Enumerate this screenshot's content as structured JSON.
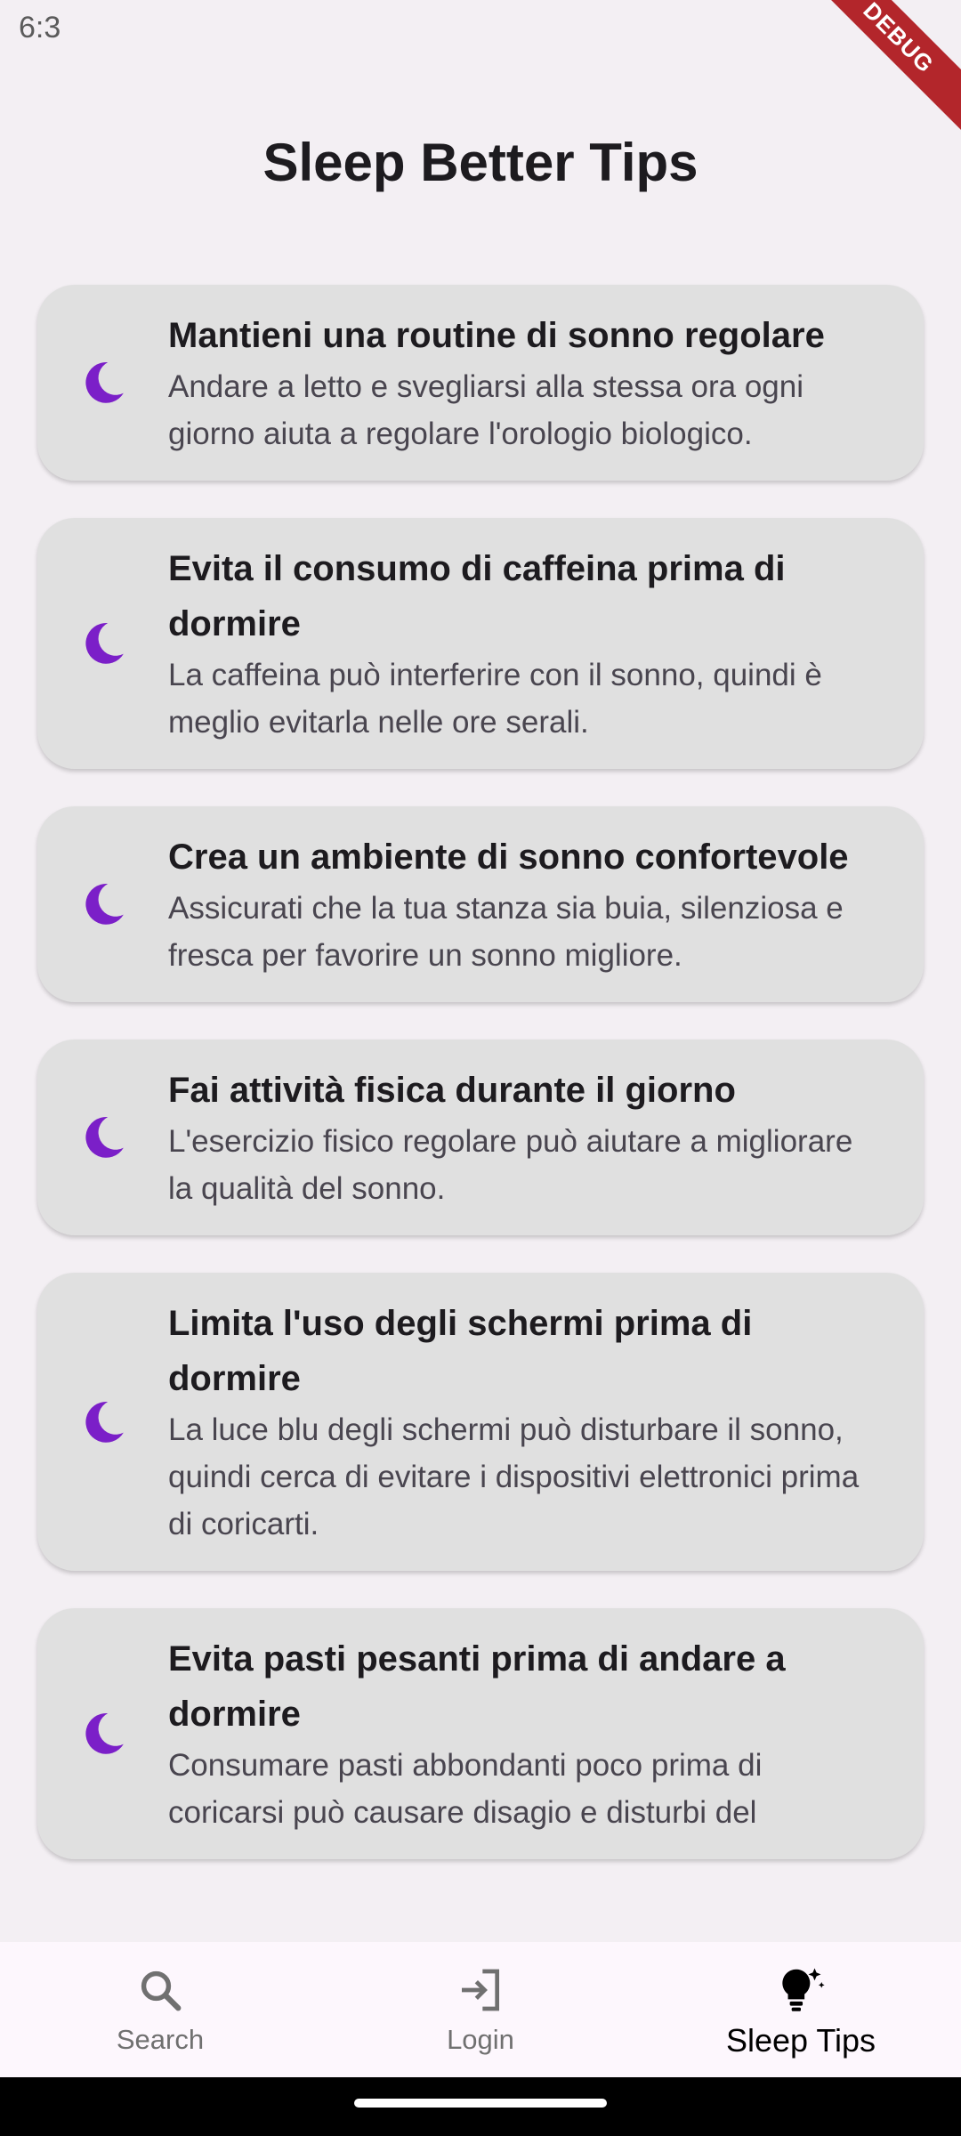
{
  "status_bar": {
    "time": "6:3"
  },
  "debug_banner": "DEBUG",
  "page": {
    "title": "Sleep Better Tips"
  },
  "tips": [
    {
      "icon": "moon-icon",
      "title": "Mantieni una routine di sonno regolare",
      "description": "Andare a letto e svegliarsi alla stessa ora ogni giorno aiuta a regolare l'orologio biologico."
    },
    {
      "icon": "moon-icon",
      "title": "Evita il consumo di caffeina prima di dormire",
      "description": "La caffeina può interferire con il sonno, quindi è meglio evitarla nelle ore serali."
    },
    {
      "icon": "moon-icon",
      "title": "Crea un ambiente di sonno confortevole",
      "description": "Assicurati che la tua stanza sia buia, silenziosa e fresca per favorire un sonno migliore."
    },
    {
      "icon": "moon-icon",
      "title": "Fai attività fisica durante il giorno",
      "description": "L'esercizio fisico regolare può aiutare a migliorare la qualità del sonno."
    },
    {
      "icon": "moon-icon",
      "title": "Limita l'uso degli schermi prima di dormire",
      "description": "La luce blu degli schermi può disturbare il sonno, quindi cerca di evitare i dispositivi elettronici prima di coricarti."
    },
    {
      "icon": "moon-icon",
      "title": "Evita pasti pesanti prima di andare a dormire",
      "description": "Consumare pasti abbondanti poco prima di coricarsi può causare disagio e disturbi del"
    }
  ],
  "bottom_nav": {
    "items": [
      {
        "label": "Search",
        "icon": "search-icon",
        "active": false
      },
      {
        "label": "Login",
        "icon": "login-icon",
        "active": false
      },
      {
        "label": "Sleep Tips",
        "icon": "lightbulb-icon",
        "active": true
      }
    ]
  },
  "colors": {
    "accent": "#7b1fc8",
    "card_bg": "#e0e0e0",
    "page_bg": "#f3eff3",
    "nav_bg": "#fdf7fd"
  }
}
